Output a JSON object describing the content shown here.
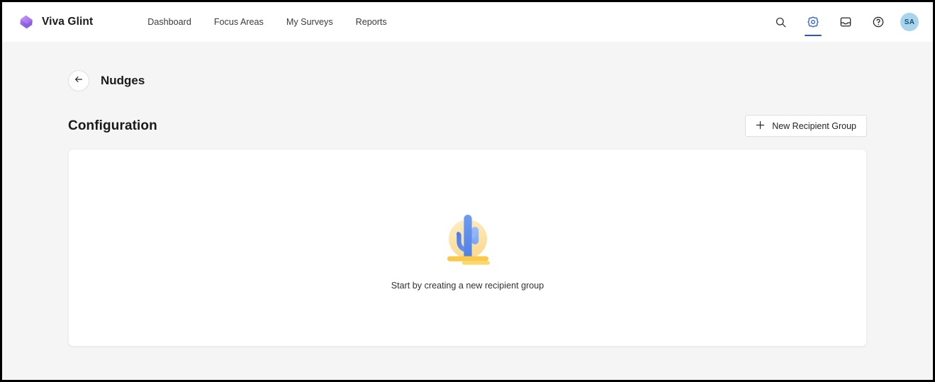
{
  "app": {
    "brand_name": "Viva Glint",
    "logo_icon": "viva-glint-diamond-logo"
  },
  "top_nav": {
    "links": [
      {
        "label": "Dashboard"
      },
      {
        "label": "Focus Areas"
      },
      {
        "label": "My Surveys"
      },
      {
        "label": "Reports"
      }
    ],
    "actions": [
      {
        "icon": "search-icon",
        "active": false
      },
      {
        "icon": "gear-icon",
        "active": true
      },
      {
        "icon": "inbox-icon",
        "active": false
      },
      {
        "icon": "help-icon",
        "active": false
      }
    ],
    "avatar_initials": "SA"
  },
  "page": {
    "back_icon": "arrow-left-icon",
    "title": "Nudges"
  },
  "section": {
    "title": "Configuration",
    "new_group_button": {
      "label": "New Recipient Group",
      "icon": "plus-icon"
    }
  },
  "empty_state": {
    "illustration": "cactus-desert-illustration",
    "message": "Start by creating a new recipient group"
  },
  "colors": {
    "accent_blue": "#2557c7",
    "brand_purple": "#b57bef",
    "avatar_bg": "#a8d4ee",
    "avatar_text": "#1b4f72",
    "page_bg": "#f5f5f5",
    "card_bg": "#ffffff",
    "cactus_blue": "#5b8def",
    "cactus_blue_light": "#8fb4f5",
    "sun_yellow": "#fbe3a8",
    "ground_yellow": "#fbc94a"
  }
}
